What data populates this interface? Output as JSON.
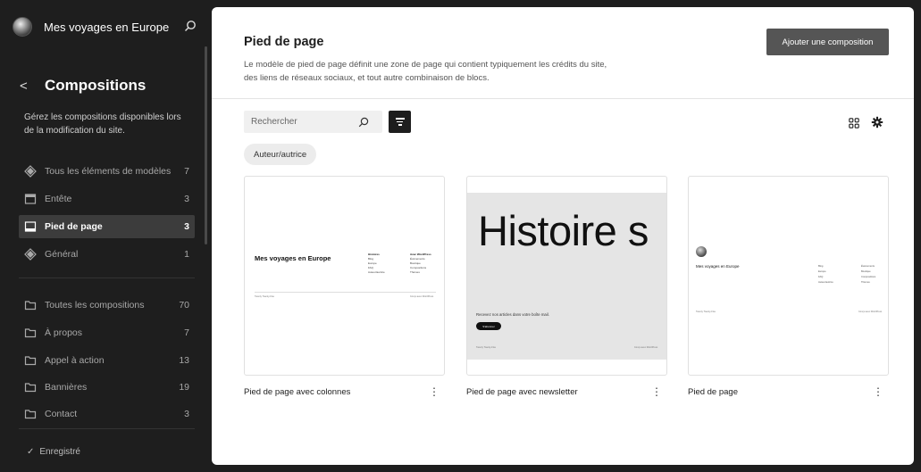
{
  "site": {
    "title": "Mes voyages en Europe"
  },
  "sidebar": {
    "back_label": "<",
    "title": "Compositions",
    "description": "Gérez les compositions disponibles lors de la modification du site.",
    "template_parts": [
      {
        "label": "Tous les éléments de modèles",
        "count": "7",
        "icon": "symbol-diamond-icon"
      },
      {
        "label": "Entête",
        "count": "3",
        "icon": "header-icon"
      },
      {
        "label": "Pied de page",
        "count": "3",
        "icon": "footer-icon",
        "active": true
      },
      {
        "label": "Général",
        "count": "1",
        "icon": "symbol-diamond-icon"
      }
    ],
    "categories": [
      {
        "label": "Toutes les compositions",
        "count": "70"
      },
      {
        "label": "À propos",
        "count": "7"
      },
      {
        "label": "Appel à action",
        "count": "13"
      },
      {
        "label": "Bannières",
        "count": "19"
      },
      {
        "label": "Contact",
        "count": "3"
      }
    ],
    "saved": "Enregistré"
  },
  "main": {
    "title": "Pied de page",
    "description": "Le modèle de pied de page définit une zone de page qui contient typiquement les crédits du site, des liens de réseaux sociaux, et tout autre combinaison de blocs.",
    "add_button": "Ajouter une composition",
    "search_placeholder": "Rechercher",
    "chip": "Auteur/autrice",
    "cards": [
      {
        "title": "Pied de page avec colonnes"
      },
      {
        "title": "Pied de page avec newsletter"
      },
      {
        "title": "Pied de page"
      }
    ]
  },
  "previews": {
    "p1": {
      "site": "Mes voyages en Europe",
      "col1": [
        "Histoires",
        "Blog",
        "Europe",
        "FAQ",
        "Auteur/autrice"
      ],
      "col2": [
        "Avec WordPress",
        "Événements",
        "Boutique",
        "Compositions",
        "Thèmes"
      ],
      "foot_left": "Twenty Twenty-Five",
      "foot_right": "Conçu avec WordPress"
    },
    "p2": {
      "big": "Histoire s",
      "sub": "Recevez nos articles dans votre boîte mail.",
      "btn": "S'abonner",
      "foot_left": "Twenty Twenty-Five",
      "foot_right": "Conçu avec WordPress"
    },
    "p3": {
      "site": "Mes voyages en Europe",
      "col1": [
        "Blog",
        "Europe",
        "FAQ",
        "Auteur/autrice"
      ],
      "col2": [
        "Événements",
        "Boutique",
        "Compositions",
        "Thèmes"
      ],
      "foot_left": "Twenty Twenty-Five",
      "foot_right": "Conçu avec WordPress"
    }
  }
}
